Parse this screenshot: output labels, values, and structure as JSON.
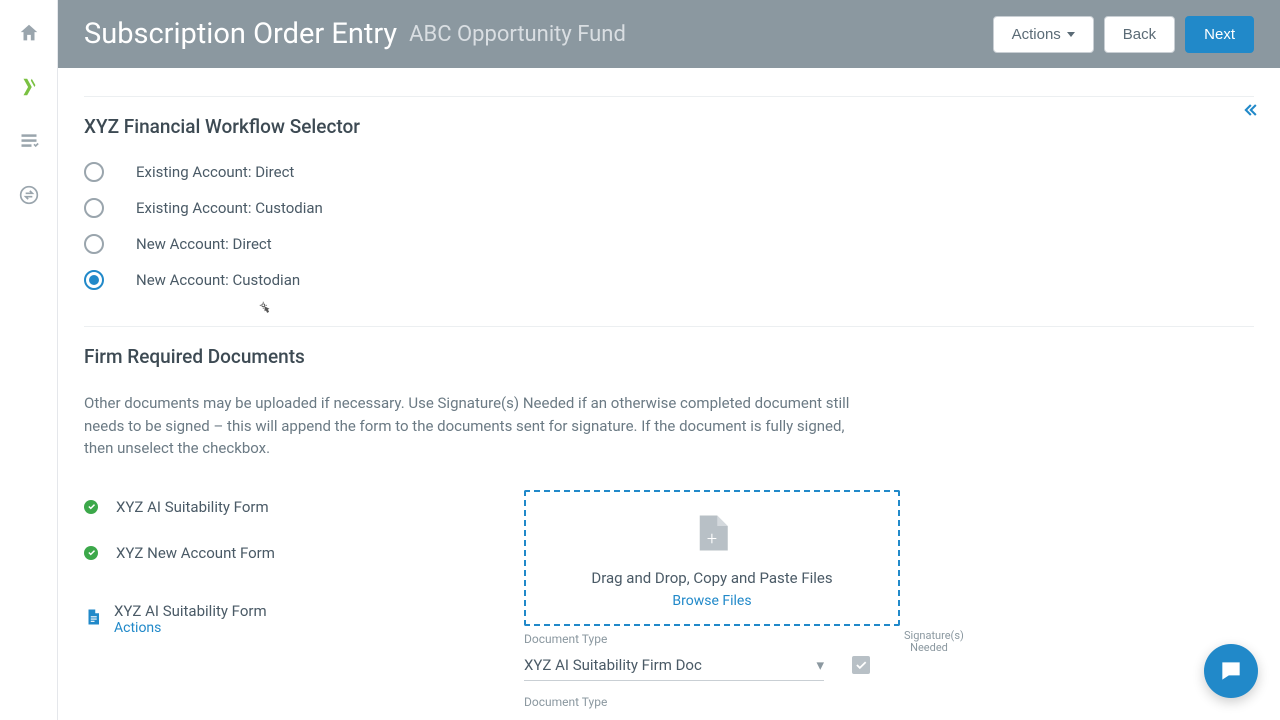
{
  "sidebar": {
    "items": [
      {
        "name": "home"
      },
      {
        "name": "brand-x"
      },
      {
        "name": "list-check"
      },
      {
        "name": "transfer"
      }
    ]
  },
  "header": {
    "title": "Subscription Order Entry",
    "subtitle": "ABC Opportunity Fund",
    "actions_label": "Actions",
    "back_label": "Back",
    "next_label": "Next"
  },
  "workflow": {
    "title": "XYZ Financial Workflow Selector",
    "options": [
      {
        "label": "Existing Account: Direct",
        "selected": false
      },
      {
        "label": "Existing Account: Custodian",
        "selected": false
      },
      {
        "label": "New Account: Direct",
        "selected": false
      },
      {
        "label": "New Account: Custodian",
        "selected": true
      }
    ]
  },
  "documents": {
    "title": "Firm Required Documents",
    "description": "Other documents may be uploaded if necessary. Use Signature(s) Needed if an otherwise completed document still needs to be signed – this will append the form to the documents sent for signature. If the document is fully signed, then unselect the checkbox.",
    "required": [
      {
        "label": "XYZ AI Suitability Form"
      },
      {
        "label": "XYZ New Account Form"
      }
    ],
    "dropzone": {
      "text": "Drag and Drop, Copy and Paste Files",
      "browse": "Browse Files"
    },
    "signature_header": "Signature(s) Needed",
    "uploaded": {
      "name": "XYZ AI Suitability Form",
      "actions_label": "Actions"
    },
    "doc_type_label": "Document Type",
    "doc_type_value": "XYZ AI Suitability Firm Doc",
    "doc_type_label2": "Document Type"
  }
}
